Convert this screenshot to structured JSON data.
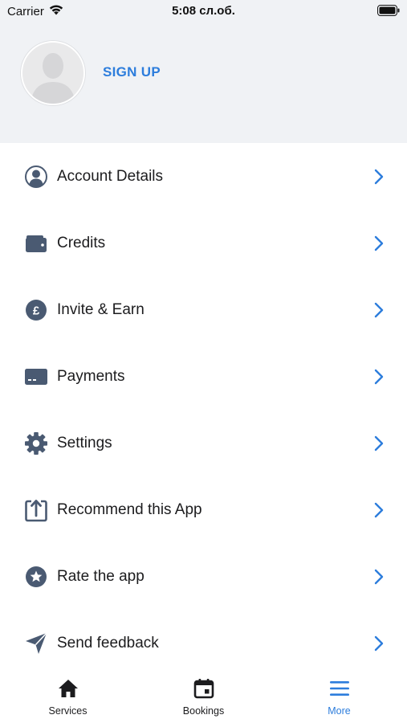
{
  "status_bar": {
    "carrier": "Carrier",
    "time": "5:08 сл.об."
  },
  "profile": {
    "signup_label": "SIGN UP"
  },
  "menu": {
    "items": [
      {
        "label": "Account Details",
        "icon": "user-circle-icon"
      },
      {
        "label": "Credits",
        "icon": "wallet-icon"
      },
      {
        "label": "Invite & Earn",
        "icon": "pound-coin-icon"
      },
      {
        "label": "Payments",
        "icon": "card-icon"
      },
      {
        "label": "Settings",
        "icon": "gear-icon"
      },
      {
        "label": "Recommend this App",
        "icon": "share-icon"
      },
      {
        "label": "Rate the app",
        "icon": "star-circle-icon"
      },
      {
        "label": "Send feedback",
        "icon": "paper-plane-icon"
      }
    ]
  },
  "tabbar": {
    "tabs": [
      {
        "label": "Services",
        "icon": "home-icon"
      },
      {
        "label": "Bookings",
        "icon": "calendar-icon"
      },
      {
        "label": "More",
        "icon": "menu-lines-icon"
      }
    ],
    "active": "More"
  },
  "colors": {
    "accent": "#2d7ddc",
    "icon": "#4a5a72",
    "header_bg": "#f0f2f5"
  }
}
